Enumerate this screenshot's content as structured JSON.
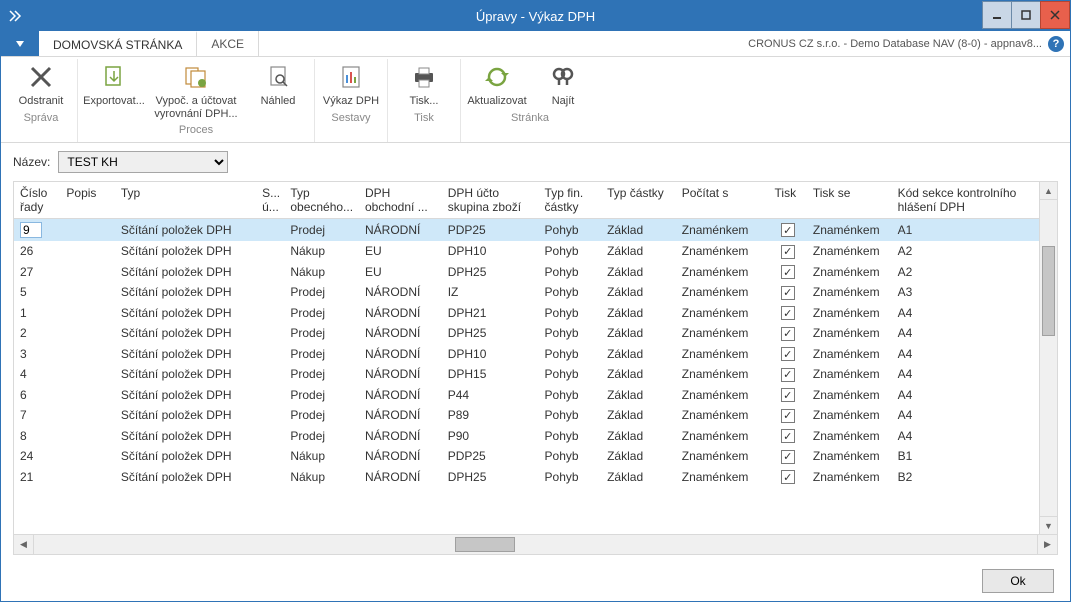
{
  "titlebar": {
    "title": "Úpravy - Výkaz DPH"
  },
  "tabs": {
    "home": "DOMOVSKÁ STRÁNKA",
    "actions": "AKCE"
  },
  "context": "CRONUS CZ s.r.o. - Demo Database NAV (8-0) - appnav8...",
  "ribbon_groups": {
    "sprava": "Správa",
    "proces": "Proces",
    "sestavy": "Sestavy",
    "tisk": "Tisk",
    "stranka": "Stránka"
  },
  "ribbon": {
    "odstranit": "Odstranit",
    "exportovat": "Exportovat...",
    "vypoc": "Vypoč. a účtovat vyrovnání DPH...",
    "nahled": "Náhled",
    "vykaz": "Výkaz DPH",
    "tisk_btn": "Tisk...",
    "aktualizovat": "Aktualizovat",
    "najit": "Najít"
  },
  "name_label": "Název:",
  "name_value": "TEST KH",
  "columns": {
    "row_no": "Číslo řady",
    "popis": "Popis",
    "typ": "Typ",
    "su": "S... ú...",
    "typ_obec": "Typ obecného...",
    "dph_obch": "DPH obchodní ...",
    "dph_ucto": "DPH účto skupina zboží",
    "typ_fin": "Typ fin. částky",
    "typ_castky": "Typ částky",
    "pocitat": "Počítat s",
    "tisk": "Tisk",
    "tisk_se": "Tisk se",
    "kod": "Kód sekce kontrolního hlášení DPH"
  },
  "rows": [
    {
      "row": "9",
      "typ": "Sčítání položek DPH",
      "gen": "Prodej",
      "bus": "NÁRODNÍ",
      "prod": "PDP25",
      "fin": "Pohyb",
      "amt": "Základ",
      "calc": "Znaménkem",
      "print": true,
      "printw": "Znaménkem",
      "kh": "A1",
      "selected": true
    },
    {
      "row": "26",
      "typ": "Sčítání položek DPH",
      "gen": "Nákup",
      "bus": "EU",
      "prod": "DPH10",
      "fin": "Pohyb",
      "amt": "Základ",
      "calc": "Znaménkem",
      "print": true,
      "printw": "Znaménkem",
      "kh": "A2"
    },
    {
      "row": "27",
      "typ": "Sčítání položek DPH",
      "gen": "Nákup",
      "bus": "EU",
      "prod": "DPH25",
      "fin": "Pohyb",
      "amt": "Základ",
      "calc": "Znaménkem",
      "print": true,
      "printw": "Znaménkem",
      "kh": "A2"
    },
    {
      "row": "5",
      "typ": "Sčítání položek DPH",
      "gen": "Prodej",
      "bus": "NÁRODNÍ",
      "prod": "IZ",
      "fin": "Pohyb",
      "amt": "Základ",
      "calc": "Znaménkem",
      "print": true,
      "printw": "Znaménkem",
      "kh": "A3"
    },
    {
      "row": "1",
      "typ": "Sčítání položek DPH",
      "gen": "Prodej",
      "bus": "NÁRODNÍ",
      "prod": "DPH21",
      "fin": "Pohyb",
      "amt": "Základ",
      "calc": "Znaménkem",
      "print": true,
      "printw": "Znaménkem",
      "kh": "A4"
    },
    {
      "row": "2",
      "typ": "Sčítání položek DPH",
      "gen": "Prodej",
      "bus": "NÁRODNÍ",
      "prod": "DPH25",
      "fin": "Pohyb",
      "amt": "Základ",
      "calc": "Znaménkem",
      "print": true,
      "printw": "Znaménkem",
      "kh": "A4"
    },
    {
      "row": "3",
      "typ": "Sčítání položek DPH",
      "gen": "Prodej",
      "bus": "NÁRODNÍ",
      "prod": "DPH10",
      "fin": "Pohyb",
      "amt": "Základ",
      "calc": "Znaménkem",
      "print": true,
      "printw": "Znaménkem",
      "kh": "A4"
    },
    {
      "row": "4",
      "typ": "Sčítání položek DPH",
      "gen": "Prodej",
      "bus": "NÁRODNÍ",
      "prod": "DPH15",
      "fin": "Pohyb",
      "amt": "Základ",
      "calc": "Znaménkem",
      "print": true,
      "printw": "Znaménkem",
      "kh": "A4"
    },
    {
      "row": "6",
      "typ": "Sčítání položek DPH",
      "gen": "Prodej",
      "bus": "NÁRODNÍ",
      "prod": "P44",
      "fin": "Pohyb",
      "amt": "Základ",
      "calc": "Znaménkem",
      "print": true,
      "printw": "Znaménkem",
      "kh": "A4"
    },
    {
      "row": "7",
      "typ": "Sčítání položek DPH",
      "gen": "Prodej",
      "bus": "NÁRODNÍ",
      "prod": "P89",
      "fin": "Pohyb",
      "amt": "Základ",
      "calc": "Znaménkem",
      "print": true,
      "printw": "Znaménkem",
      "kh": "A4"
    },
    {
      "row": "8",
      "typ": "Sčítání položek DPH",
      "gen": "Prodej",
      "bus": "NÁRODNÍ",
      "prod": "P90",
      "fin": "Pohyb",
      "amt": "Základ",
      "calc": "Znaménkem",
      "print": true,
      "printw": "Znaménkem",
      "kh": "A4"
    },
    {
      "row": "24",
      "typ": "Sčítání položek DPH",
      "gen": "Nákup",
      "bus": "NÁRODNÍ",
      "prod": "PDP25",
      "fin": "Pohyb",
      "amt": "Základ",
      "calc": "Znaménkem",
      "print": true,
      "printw": "Znaménkem",
      "kh": "B1"
    },
    {
      "row": "21",
      "typ": "Sčítání položek DPH",
      "gen": "Nákup",
      "bus": "NÁRODNÍ",
      "prod": "DPH25",
      "fin": "Pohyb",
      "amt": "Základ",
      "calc": "Znaménkem",
      "print": true,
      "printw": "Znaménkem",
      "kh": "B2"
    }
  ],
  "ok_label": "Ok"
}
